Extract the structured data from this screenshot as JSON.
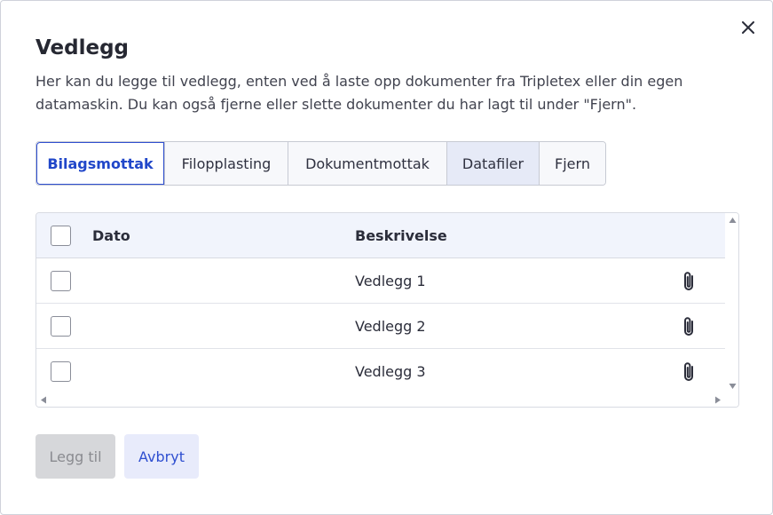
{
  "dialog": {
    "title": "Vedlegg",
    "description": "Her kan du legge til vedlegg, enten ved å laste opp dokumenter fra Tripletex eller din egen datamaskin. Du kan også fjerne eller slette dokumenter du har lagt til under \"Fjern\"."
  },
  "tabs": [
    {
      "label": "Bilagsmottak",
      "state": "active"
    },
    {
      "label": "Filopplasting",
      "state": "default"
    },
    {
      "label": "Dokumentmottak",
      "state": "default"
    },
    {
      "label": "Datafiler",
      "state": "hover"
    },
    {
      "label": "Fjern",
      "state": "default"
    }
  ],
  "table": {
    "headers": {
      "date": "Dato",
      "description": "Beskrivelse"
    },
    "rows": [
      {
        "date": "",
        "description": "Vedlegg 1",
        "icon": "paperclip-icon"
      },
      {
        "date": "",
        "description": "Vedlegg 2",
        "icon": "paperclip-icon"
      },
      {
        "date": "",
        "description": "Vedlegg 3",
        "icon": "paperclip-icon"
      }
    ]
  },
  "footer": {
    "add_label": "Legg til",
    "add_state": "disabled",
    "cancel_label": "Avbryt"
  },
  "colors": {
    "accent": "#2f4fd0",
    "header_bg": "#f1f4fc",
    "tab_hover_bg": "#e6eaf7",
    "disabled_bg": "#d6d7da",
    "cancel_bg": "#e8ebfb"
  },
  "icons": {
    "close": "close-icon",
    "attachment": "paperclip-icon",
    "scroll_up": "arrow-up-icon",
    "scroll_down": "arrow-down-icon",
    "scroll_left": "arrow-left-icon",
    "scroll_right": "arrow-right-icon"
  }
}
